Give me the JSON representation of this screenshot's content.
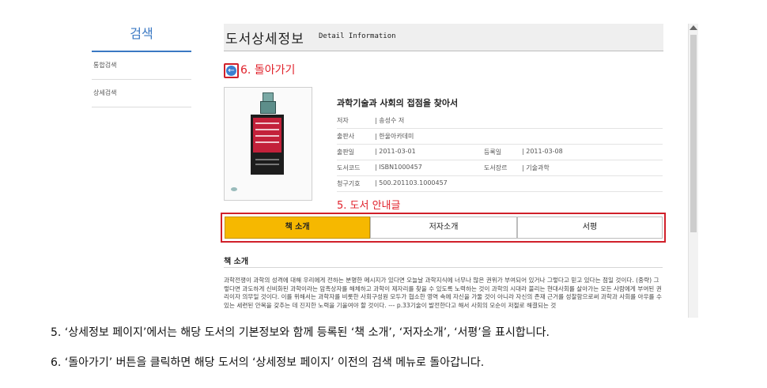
{
  "sidebar": {
    "title": "검색",
    "items": [
      {
        "label": "통합검색"
      },
      {
        "label": "상세검색"
      }
    ]
  },
  "header": {
    "title_ko": "도서상세정보",
    "title_en": "Detail Information"
  },
  "annotations": {
    "back": "6. 돌아가기",
    "guide": "5. 도서 안내글"
  },
  "book": {
    "title": "과학기술과 사회의 접점을 찾아서",
    "rows": [
      {
        "label": "저자",
        "value": "| 송성수 저"
      },
      {
        "label": "출판사",
        "value": "| 한울아카데미"
      },
      {
        "label": "출판일",
        "value": "| 2011-03-01",
        "label2": "등록일",
        "value2": "| 2011-03-08"
      },
      {
        "label": "도서코드",
        "value": "| ISBN1000457",
        "label2": "도서장르",
        "value2": "| 기술과학"
      },
      {
        "label": "청구기호",
        "value": "| 500.201103.1000457"
      }
    ]
  },
  "tabs": [
    {
      "label": "책 소개",
      "active": true
    },
    {
      "label": "저자소개",
      "active": false
    },
    {
      "label": "서평",
      "active": false
    }
  ],
  "intro": {
    "heading": "책 소개",
    "text": "과학전쟁이 과학의 성격에 대해 우리에게 전하는 분명한 메시지가 있다면 오늘날 과학지식에 너무나 많은 권위가 부여되어 있거나 그렇다고 믿고 있다는 점일 것이다. (중략) 그렇다면 과도하게 신비화된 과학이라는 암흑상자를 해체하고 과학이 제자리를 찾을 수 있도록 노력하는 것이 과학의 시대라 불리는 현대사회를 살아가는 모든 사람에게 부여된 권리이자 의무일 것이다. 이를 위해서는 과학자를 비롯한 사회구성원 모두가 협소한 영역 속에 자신을 가둘 것이 아니라 자신의 존재 근거를 성찰함으로써 과학과 사회를 아우를 수 있는 세련된 안목을 갖추는 데 진지한 노력을 기울여야 할 것이다. --- p.33기술이 발전한다고 해서 사회의 모순이 저절로 해결되는 것"
  },
  "captions": [
    "5. ‘상세정보 페이지’에서는 해당 도서의 기본정보와 함께 등록된 ‘책 소개’, ‘저자소개’, ‘서평’을 표시합니다.",
    "6. ‘돌아가기’ 버튼을 클릭하면 해당 도서의 ‘상세정보 페이지’ 이전의 검색 메뉴로 돌아갑니다."
  ],
  "colors": {
    "accent": "#3a78c3",
    "annotation_red": "#d0202a",
    "active_tab": "#f6b800"
  },
  "icons": {
    "back": "back-arrow-circle-icon"
  }
}
